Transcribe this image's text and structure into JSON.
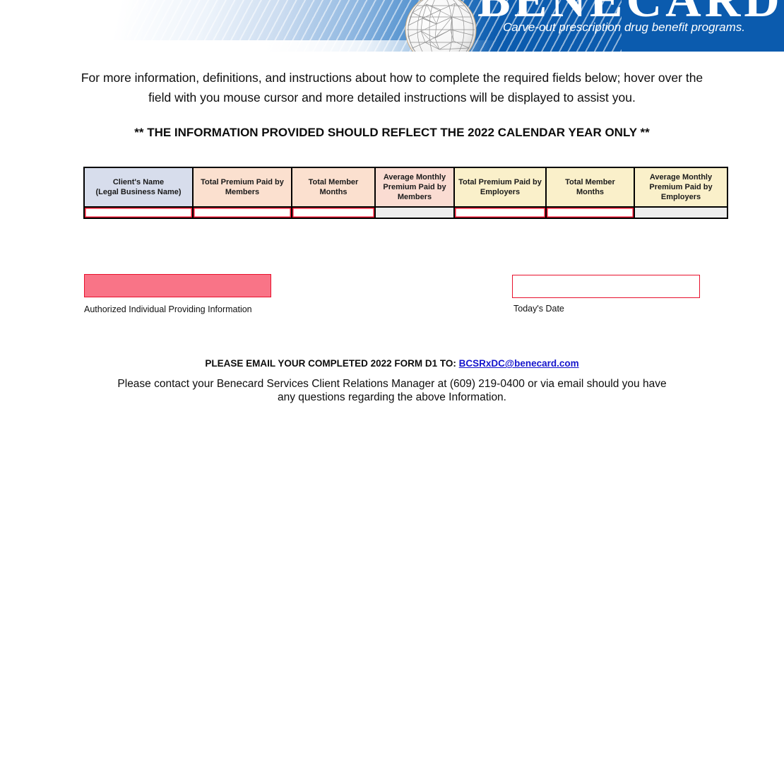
{
  "header": {
    "brand_name": "BENECARD",
    "tagline": "Carve-out prescription drug benefit programs.",
    "logo_icon": "globe-wireframe-icon",
    "banner_color": "#0B5BAE"
  },
  "intro": {
    "text": "For more information, definitions, and instructions about how to complete the required fields below; hover over the field with you mouse cursor and more detailed instructions will be displayed to assist you."
  },
  "notice": {
    "text": "** THE INFORMATION PROVIDED SHOULD REFLECT THE 2022 CALENDAR YEAR ONLY **"
  },
  "table": {
    "columns": [
      {
        "label": "Client's Name\n(Legal Business Name)",
        "line1": "Client's Name",
        "line2": "(Legal Business Name)",
        "header_color": "#D7DDEC",
        "input_type": "editable"
      },
      {
        "line1": "Total Premium Paid by",
        "line2": "Members",
        "header_color": "#FBE0CF",
        "input_type": "editable"
      },
      {
        "line1": "Total Member",
        "line2": "Months",
        "header_color": "#FBE0CF",
        "input_type": "editable"
      },
      {
        "line1": "Average Monthly",
        "line2": "Premium Paid by",
        "line3": "Members",
        "header_color": "#FADCD2",
        "input_type": "calculated"
      },
      {
        "line1": "Total Premium Paid by",
        "line2": "Employers",
        "header_color": "#FAF0CA",
        "input_type": "editable"
      },
      {
        "line1": "Total Member",
        "line2": "Months",
        "header_color": "#FAF0CA",
        "input_type": "editable"
      },
      {
        "line1": "Average Monthly",
        "line2": "Premium Paid by",
        "line3": "Employers",
        "header_color": "#FAF0CA",
        "input_type": "calculated"
      }
    ],
    "rows": [
      {
        "values": [
          "",
          "",
          "",
          "",
          "",
          "",
          ""
        ]
      }
    ]
  },
  "signature": {
    "field_value": "",
    "field_color": "#F97487",
    "label": "Authorized Individual Providing Information"
  },
  "date": {
    "field_value": "",
    "label": "Today's Date"
  },
  "footer": {
    "email_prefix": "PLEASE EMAIL YOUR COMPLETED 2022 FORM D1 TO:",
    "email_address": "BCSRxDC@benecard.com",
    "contact_line1": "Please contact your Benecard Services Client Relations Manager at (609) 219-0400 or via email should you have",
    "contact_line2": "any questions regarding the above Information."
  }
}
